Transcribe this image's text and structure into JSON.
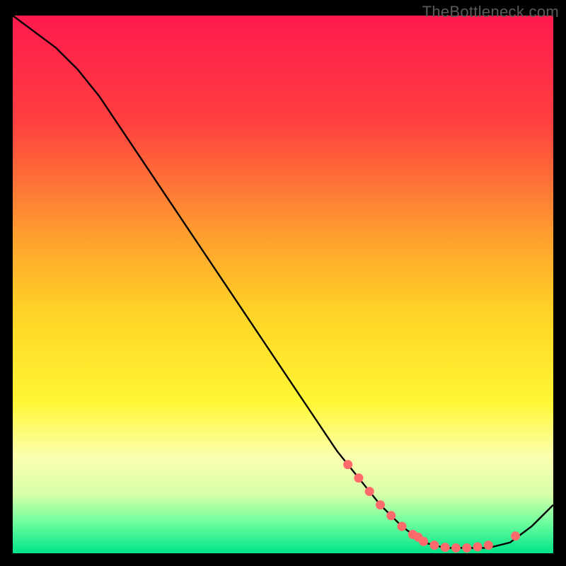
{
  "watermark": "TheBottleneck.com",
  "chart_data": {
    "type": "line",
    "title": "",
    "xlabel": "",
    "ylabel": "",
    "xlim": [
      0,
      100
    ],
    "ylim": [
      0,
      100
    ],
    "grid": false,
    "legend": false,
    "background_gradient": {
      "stops": [
        {
          "offset": 0.0,
          "color": "#ff1a4d"
        },
        {
          "offset": 0.2,
          "color": "#ff4040"
        },
        {
          "offset": 0.4,
          "color": "#ff9b2f"
        },
        {
          "offset": 0.55,
          "color": "#ffd326"
        },
        {
          "offset": 0.72,
          "color": "#fff735"
        },
        {
          "offset": 0.82,
          "color": "#fbffb0"
        },
        {
          "offset": 0.89,
          "color": "#d8ffa8"
        },
        {
          "offset": 0.94,
          "color": "#73ff9e"
        },
        {
          "offset": 1.0,
          "color": "#00e48a"
        }
      ]
    },
    "series": [
      {
        "name": "curve",
        "x": [
          0,
          4,
          8,
          12,
          16,
          20,
          24,
          28,
          32,
          36,
          40,
          44,
          48,
          52,
          56,
          60,
          64,
          68,
          72,
          76,
          80,
          84,
          88,
          92,
          96,
          100
        ],
        "y": [
          100,
          97,
          94,
          90,
          85,
          79,
          73,
          67,
          61,
          55,
          49,
          43,
          37,
          31,
          25,
          19,
          14,
          9,
          5,
          2,
          1,
          1,
          1,
          2,
          5,
          9
        ]
      }
    ],
    "markers": {
      "name": "highlight-points",
      "color": "#ff6b6b",
      "x": [
        62,
        64,
        66,
        68,
        70,
        72,
        74,
        75,
        76,
        78,
        80,
        82,
        84,
        86,
        88,
        93
      ],
      "y": [
        16.5,
        14,
        11.5,
        9,
        7,
        5,
        3.5,
        3,
        2.2,
        1.5,
        1.1,
        1,
        1,
        1.2,
        1.5,
        3.2
      ]
    }
  }
}
